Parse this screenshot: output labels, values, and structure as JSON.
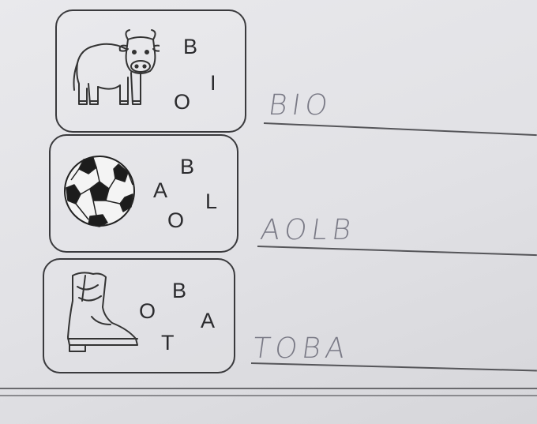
{
  "exercises": [
    {
      "picture": "cow-icon",
      "letters": [
        "B",
        "I",
        "O"
      ],
      "answer": "BIO"
    },
    {
      "picture": "soccer-ball-icon",
      "letters": [
        "B",
        "A",
        "L",
        "O"
      ],
      "answer": "AOLB"
    },
    {
      "picture": "boot-icon",
      "letters": [
        "B",
        "O",
        "A",
        "T"
      ],
      "answer": "TOBA"
    }
  ]
}
